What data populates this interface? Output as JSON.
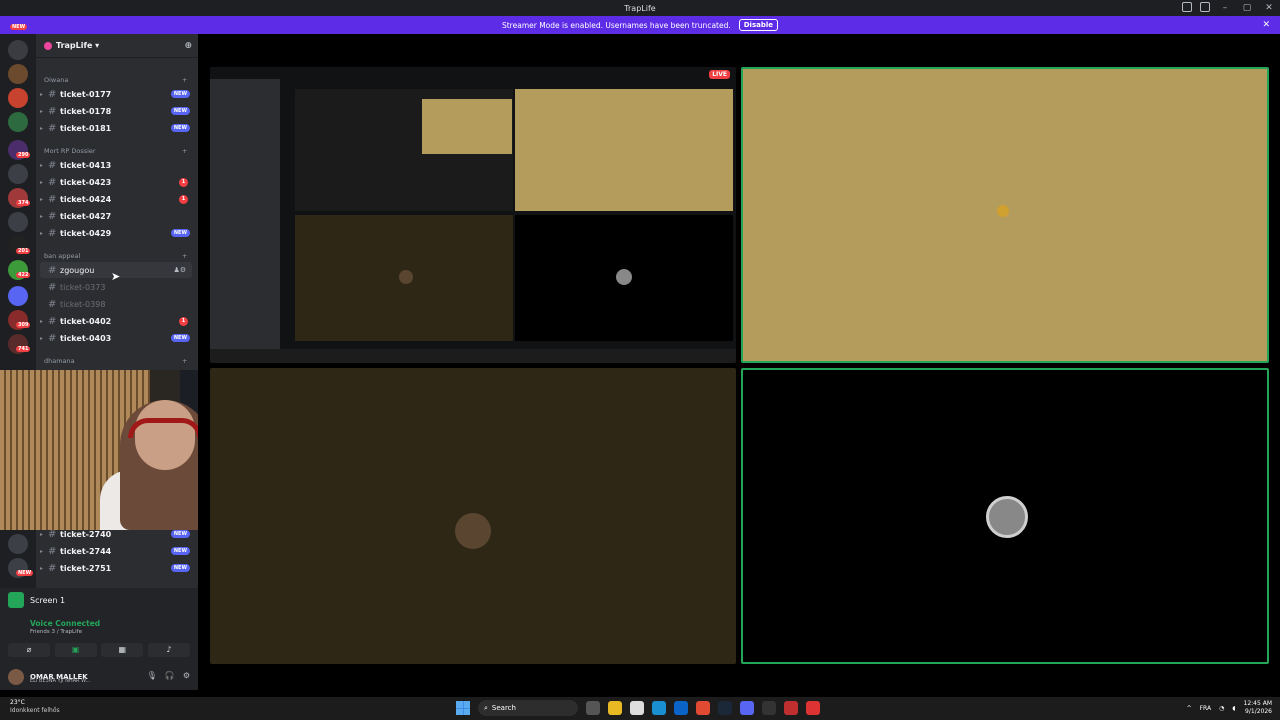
{
  "app": {
    "title": "TrapLife"
  },
  "banner": {
    "text": "Streamer Mode is enabled. Usernames have been truncated.",
    "button": "Disable"
  },
  "server": {
    "name": "TrapLife ▾"
  },
  "categories": [
    {
      "name": "Oiwana"
    },
    {
      "name": "Mort RP Dossier"
    },
    {
      "name": "ban appeal"
    },
    {
      "name": "dhamana"
    }
  ],
  "channels": [
    {
      "name": "ticket-0177",
      "badge": "NEW"
    },
    {
      "name": "ticket-0178",
      "badge": "NEW"
    },
    {
      "name": "ticket-0181",
      "badge": "NEW"
    },
    {
      "name": "ticket-0413",
      "badge": ""
    },
    {
      "name": "ticket-0423",
      "badge": "1"
    },
    {
      "name": "ticket-0424",
      "badge": "1"
    },
    {
      "name": "ticket-0427",
      "badge": ""
    },
    {
      "name": "ticket-0429",
      "badge": "NEW"
    },
    {
      "name": "zgougou",
      "badge": ""
    },
    {
      "name": "ticket-0373",
      "badge": ""
    },
    {
      "name": "ticket-0398",
      "badge": ""
    },
    {
      "name": "ticket-0402",
      "badge": "1"
    },
    {
      "name": "ticket-0403",
      "badge": "NEW"
    }
  ],
  "bottom_channels": [
    {
      "name": "ticket-2740",
      "badge": "NEW"
    },
    {
      "name": "ticket-2744",
      "badge": "NEW"
    },
    {
      "name": "ticket-2751",
      "badge": "NEW"
    }
  ],
  "guild_badges": [
    "NEW",
    "290",
    "374",
    "201",
    "422",
    "309",
    "741",
    "NEW"
  ],
  "voice": {
    "screen": "Screen 1",
    "status": "Voice Connected",
    "channel": "Friends 3 / TrapLife"
  },
  "user": {
    "name": "OMAR MALLEK",
    "status": "ELI BE3NA YJI NHAR W..."
  },
  "stage": {
    "live": "LIVE"
  },
  "taskbar": {
    "temp": "23°C",
    "weather": "Idonkkent felhős",
    "search": "Search",
    "lang": "FRA",
    "time": "12:45 AM",
    "date": "9/1/2026"
  },
  "colors": {
    "accent": "#5865f2",
    "banner": "#5c2ce6",
    "speaking": "#23a55a",
    "mention": "#f23f43"
  }
}
